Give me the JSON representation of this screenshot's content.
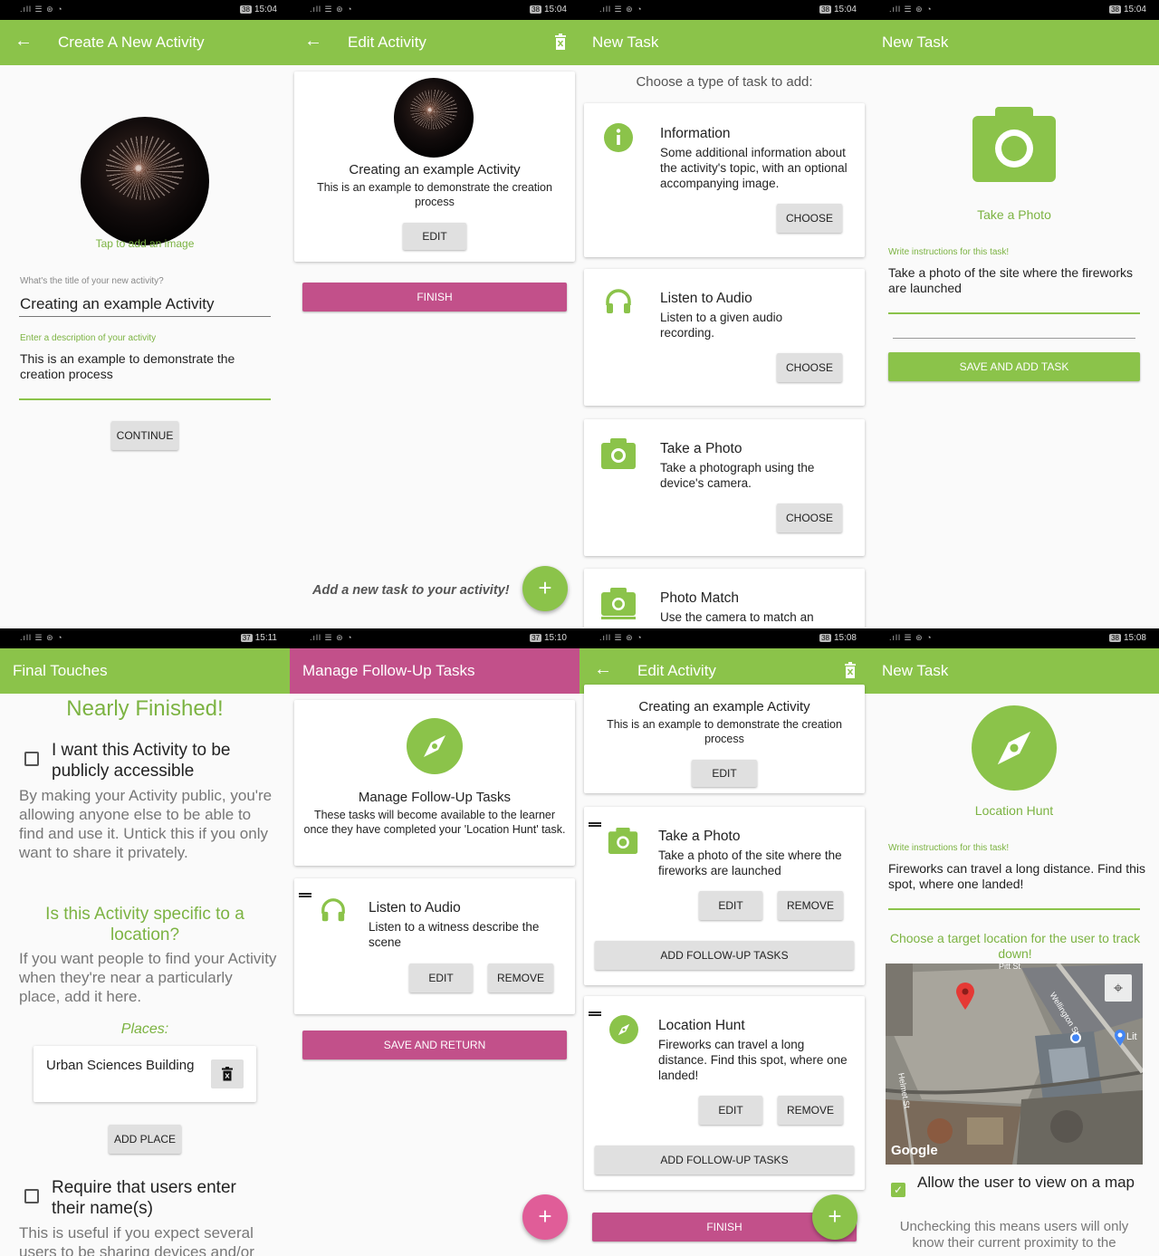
{
  "s1": {
    "time": "15:04",
    "battery": "38",
    "title": "Create A New Activity",
    "image_hint": "Tap to add an image",
    "title_label": "What's the title of your new activity?",
    "title_value": "Creating an example Activity",
    "desc_label": "Enter a description of your activity",
    "desc_value": "This is an example to demonstrate the creation process",
    "continue": "CONTINUE"
  },
  "s2": {
    "time": "15:04",
    "battery": "38",
    "title": "Edit Activity",
    "card_title": "Creating an example Activity",
    "card_desc": "This is an example to demonstrate the creation process",
    "edit": "EDIT",
    "finish": "FINISH",
    "hint": "Add a new task to your activity!",
    "fab": "+"
  },
  "s3": {
    "time": "15:04",
    "battery": "38",
    "title": "New Task",
    "prompt": "Choose a type of task to add:",
    "tasks": [
      {
        "name": "Information",
        "desc": "Some additional information about the activity's topic, with an optional accompanying image.",
        "button": "CHOOSE",
        "icon": "info-icon"
      },
      {
        "name": "Listen to Audio",
        "desc": "Listen to a given audio recording.",
        "button": "CHOOSE",
        "icon": "headphones-icon"
      },
      {
        "name": "Take a Photo",
        "desc": "Take a photograph using the device's camera.",
        "button": "CHOOSE",
        "icon": "camera-icon"
      },
      {
        "name": "Photo Match",
        "desc": "Use the camera to match an",
        "icon": "photo-match-icon"
      }
    ]
  },
  "s4": {
    "time": "15:04",
    "battery": "38",
    "title": "New Task",
    "task_name": "Take a Photo",
    "instr_label": "Write instructions for this task!",
    "instr_value": "Take a photo of the site where the fireworks are launched",
    "save": "SAVE AND ADD TASK"
  },
  "s5": {
    "time": "15:11",
    "battery": "37",
    "title": "Final Touches",
    "heading": "Nearly Finished!",
    "public_label": "I want this Activity to be publicly accessible",
    "public_desc": "By making your Activity public, you're allowing anyone else to be able to find and use it. Untick this if you only want to share it privately.",
    "location_heading": "Is this Activity specific to a location?",
    "location_desc": "If you want people to find your Activity when they're near a particularly place, add it here.",
    "places_label": "Places:",
    "place": "Urban Sciences Building",
    "add_place": "ADD PLACE",
    "name_label": "Require that users enter their name(s)",
    "name_desc": "This is useful if you expect several users to be sharing devices and/or"
  },
  "s6": {
    "time": "15:10",
    "battery": "37",
    "title": "Manage Follow-Up Tasks",
    "card_title": "Manage Follow-Up Tasks",
    "card_desc": "These tasks will become available to the learner once they have completed your 'Location Hunt' task.",
    "task_name": "Listen to Audio",
    "task_desc": "Listen to a witness describe the scene",
    "edit": "EDIT",
    "remove": "REMOVE",
    "save": "SAVE AND RETURN"
  },
  "s7": {
    "time": "15:08",
    "battery": "38",
    "title": "Edit Activity",
    "card_title": "Creating an example Activity",
    "card_desc": "This is an example to demonstrate the creation process",
    "edit": "EDIT",
    "task1_name": "Take a Photo",
    "task1_desc": "Take a photo of the site where the fireworks are launched",
    "task2_name": "Location Hunt",
    "task2_desc": "Fireworks can travel a long distance. Find this spot, where one landed!",
    "remove": "REMOVE",
    "followup": "ADD FOLLOW-UP TASKS",
    "finish": "FINISH",
    "fab": "+"
  },
  "s8": {
    "time": "15:08",
    "battery": "38",
    "title": "New Task",
    "task_name": "Location Hunt",
    "instr_label": "Write instructions for this task!",
    "instr_value": "Fireworks can travel a long distance. Find this spot, where one landed!",
    "target_label": "Choose a target location for the user to track down!",
    "map_logo": "Google",
    "map_street1": "Wellington St",
    "map_street2": "Helmet St",
    "map_street3": "Pitt St",
    "map_poi": "Lit",
    "allow_label": "Allow the user to view on a map",
    "allow_desc": "Unchecking this means users will only know their current proximity to the"
  }
}
